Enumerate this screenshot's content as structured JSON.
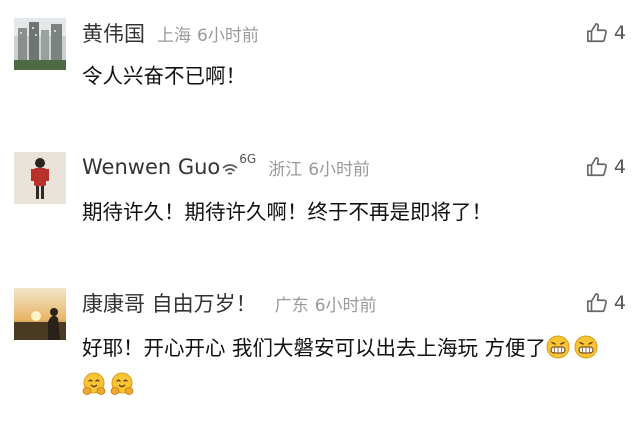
{
  "comments": [
    {
      "name": "黄伟国",
      "location": "上海",
      "time": "6小时前",
      "likes": "4",
      "text": "令人兴奋不已啊！",
      "avatar_icon": "city-buildings-avatar"
    },
    {
      "name": "Wenwen Guo",
      "network": "6G",
      "location": "浙江",
      "time": "6小时前",
      "likes": "4",
      "text": "期待许久！期待许久啊！终于不再是即将了！",
      "avatar_icon": "person-in-red-coat-avatar"
    },
    {
      "name": "康康哥 自由万岁！",
      "location": "广东",
      "time": "6小时前",
      "likes": "4",
      "text": "好耶！开心开心 我们大磐安可以出去上海玩 方便了",
      "emojis": [
        "grinning-face-emoji",
        "grinning-face-emoji",
        "hugging-face-emoji",
        "hugging-face-emoji"
      ],
      "avatar_icon": "sunset-silhouette-avatar"
    }
  ],
  "colors": {
    "name": "#333333",
    "meta": "#9a9a9a",
    "text": "#111111",
    "icon": "#666666"
  }
}
